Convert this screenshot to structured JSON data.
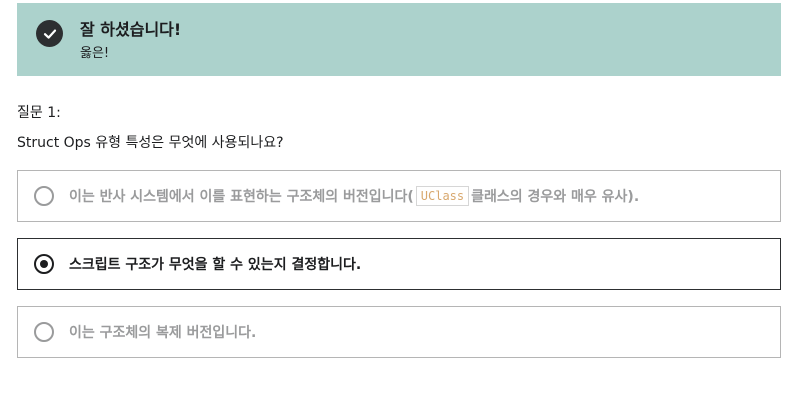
{
  "alert": {
    "title": "잘 하셨습니다!",
    "subtitle": "옳은!",
    "icon": "check-circle-icon",
    "background": "#acd2cc"
  },
  "question": {
    "label": "질문 1:",
    "text": "Struct Ops 유형 특성은 무엇에 사용되나요?"
  },
  "options": [
    {
      "text_before": "이는 반사 시스템에서 이를 표현하는 구조체의 버전입니다(",
      "code": "UClass",
      "text_after": "클래스의 경우와 매우 유사).",
      "selected": false
    },
    {
      "text": "스크립트 구조가 무엇을 할 수 있는지 결정합니다.",
      "selected": true
    },
    {
      "text": "이는 구조체의 복제 버전입니다.",
      "selected": false
    }
  ]
}
